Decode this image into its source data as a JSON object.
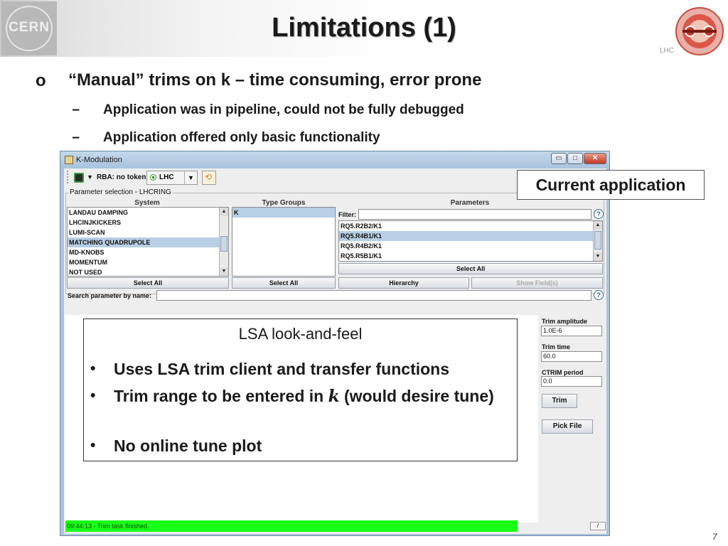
{
  "slide": {
    "title": "Limitations (1)",
    "page_number": "7",
    "lhc_label": "LHC",
    "cern_logo_text": "CERN"
  },
  "bullets": {
    "marker": "o",
    "line1": "“Manual” trims on k – time consuming, error prone",
    "dash": "−",
    "sub1": "Application was in pipeline, could not be fully debugged",
    "sub2": "Application offered only basic functionality"
  },
  "callout": "Current application",
  "lsa_box": {
    "title": "LSA look-and-feel",
    "bullet_marker": "•",
    "item1": "Uses LSA trim client and transfer functions",
    "item2_before": "Trim range to be entered in ",
    "item2_k": "k",
    "item2_after": " (would desire tune)",
    "item3": "No online tune plot"
  },
  "app": {
    "window_title": "K-Modulation",
    "toolbar": {
      "rba": "RBA: no token",
      "accelerator": "LHC"
    },
    "param_selection": {
      "label": "Parameter selection - LHCRING",
      "system_header": "System",
      "type_groups_header": "Type Groups",
      "parameters_header": "Parameters",
      "system_items": [
        "LANDAU DAMPING",
        "LHCINJKICKERS",
        "LUMI-SCAN",
        "MATCHING QUADRUPOLE",
        "MD-KNOBS",
        "MOMENTUM",
        "NOT USED"
      ],
      "type_groups_items": [
        "K"
      ],
      "filter_label": "Filter:",
      "filter_value": "",
      "parameter_items": [
        "RQ5.R2B2/K1",
        "RQ5.R4B1/K1",
        "RQ5.R4B2/K1",
        "RQ5.R5B1/K1"
      ],
      "select_all": "Select All",
      "hierarchy": "Hierarchy",
      "show_fields": "Show Field(s)"
    },
    "search": {
      "label": "Search parameter by name:",
      "value": ""
    },
    "help_symbol": "?",
    "trim": {
      "amplitude_label": "Trim amplitude",
      "amplitude_value": "1.0E-6",
      "time_label": "Trim time",
      "time_value": "60.0",
      "ctrim_label": "CTRIM period",
      "ctrim_value": "0.0",
      "trim_button": "Trim",
      "pick_file_button": "Pick File"
    },
    "status_text": "09:44:13 - Trim task finished.",
    "status_button": "/"
  }
}
